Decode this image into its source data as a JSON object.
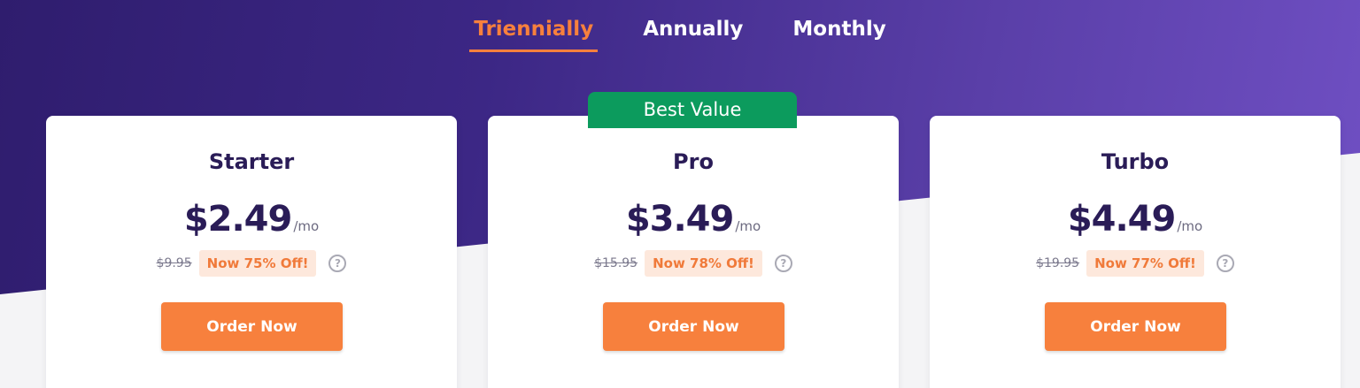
{
  "tabs": [
    {
      "label": "Triennially",
      "active": true
    },
    {
      "label": "Annually",
      "active": false
    },
    {
      "label": "Monthly",
      "active": false
    }
  ],
  "ribbon": "Best Value",
  "plans": [
    {
      "name": "Starter",
      "price": "$2.49",
      "per": "/mo",
      "old_price": "$9.95",
      "discount": "Now 75% Off!",
      "cta": "Order Now"
    },
    {
      "name": "Pro",
      "price": "$3.49",
      "per": "/mo",
      "old_price": "$15.95",
      "discount": "Now 78% Off!",
      "cta": "Order Now"
    },
    {
      "name": "Turbo",
      "price": "$4.49",
      "per": "/mo",
      "old_price": "$19.95",
      "discount": "Now 77% Off!",
      "cta": "Order Now"
    }
  ],
  "help_icon": {
    "glyph": "?",
    "icon": "question-circle-icon"
  },
  "colors": {
    "accent": "#f7803d",
    "best_value": "#0c9b5d",
    "heading": "#2a1c57",
    "hero_start": "#2f1d6e",
    "hero_end": "#7050c4"
  }
}
